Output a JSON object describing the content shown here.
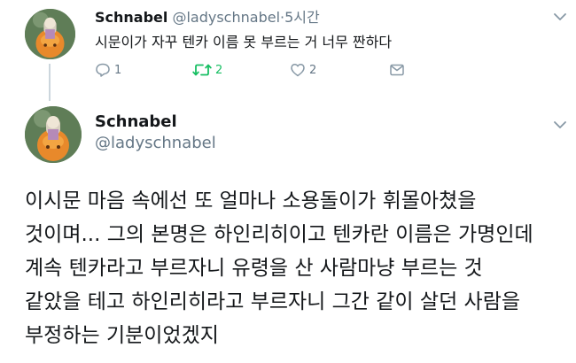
{
  "reply_tweet": {
    "display_name": "Schnabel",
    "handle": "@ladyschnabel",
    "separator": "·",
    "time": "5시간",
    "text": "시문이가 자꾸 텐카 이름 못 부르는 거 너무 짠하다",
    "actions": {
      "reply_count": "1",
      "retweet_count": "2",
      "like_count": "2",
      "retweet_active_color": "#17bf63"
    }
  },
  "main_tweet": {
    "display_name": "Schnabel",
    "handle": "@ladyschnabel",
    "lines": [
      "이시문 마음 속에선 또 얼마나 소용돌이가 휘몰아쳤을",
      "것이며... 그의 본명은 하인리히이고 텐카란 이름은 가명인데",
      "계속 텐카라고 부르자니 유령을 산 사람마냥 부르는 것",
      "같았을 테고 하인리히라고 부르자니 그간 같이 살던 사람을",
      "부정하는 기분이었겠지"
    ]
  },
  "icons": {
    "avatar": "avatar-image",
    "menu": "chevron-down-icon",
    "reply": "reply-icon",
    "retweet": "retweet-icon",
    "like": "heart-icon",
    "message": "envelope-icon"
  }
}
